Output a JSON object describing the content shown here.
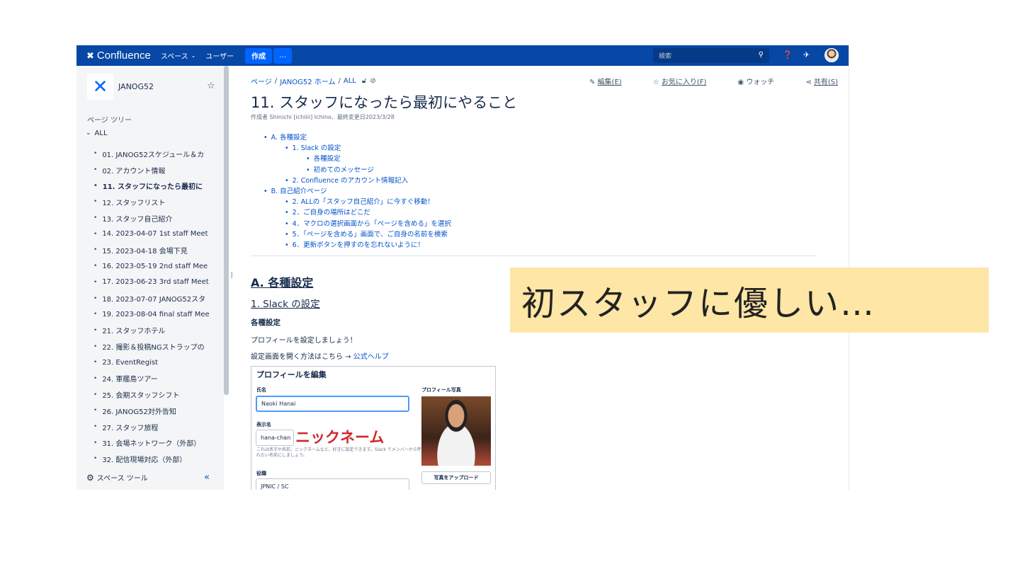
{
  "nav": {
    "brand": "Confluence",
    "spaces": "スペース",
    "users": "ユーザー",
    "create": "作成",
    "more": "…",
    "search_placeholder": "検索"
  },
  "sidebar": {
    "space_name": "JANOG52",
    "tree_heading": "ページ ツリー",
    "root": "ALL",
    "items": [
      "01. JANOG52スケジュール＆カ",
      "02. アカウント情報",
      "11. スタッフになったら最初に",
      "12. スタッフリスト",
      "13. スタッフ自己紹介",
      "14. 2023-04-07 1st staff Meet",
      "15. 2023-04-18 会場下見",
      "16. 2023-05-19 2nd staff Mee",
      "17. 2023-06-23 3rd staff Meet",
      "18. 2023-07-07 JANOG52スタ",
      "19. 2023-08-04 final staff Mee",
      "21. スタッフホテル",
      "22. 撮影＆投稿NGストラップの",
      "23. EventRegist",
      "24. 軍艦島ツアー",
      "25. 会期スタッフシフト",
      "26. JANOG52対外告知",
      "27. スタッフ旅程",
      "31. 会場ネットワーク（外部）",
      "32. 配信現場対応（外部）"
    ],
    "active_index": 2,
    "space_tools": "スペース ツール",
    "collapse": "«"
  },
  "page": {
    "breadcrumb": [
      "ページ",
      "JANOG52 ホーム",
      "ALL"
    ],
    "actions": {
      "edit": "編集(E)",
      "favorite": "お気に入り(F)",
      "watch": "ウォッチ",
      "share": "共有(S)",
      "more": "⋯"
    },
    "title": "11. スタッフになったら最初にやること",
    "byline": "作成者 Shinichi [ichiiii] Ichino、最終変更日2023/3/28",
    "toc": [
      {
        "level": 1,
        "text": "A. 各種設定"
      },
      {
        "level": 2,
        "text": "1. Slack の設定"
      },
      {
        "level": 3,
        "text": "各種設定"
      },
      {
        "level": 3,
        "text": "初めてのメッセージ"
      },
      {
        "level": 2,
        "text": "2. Confluence のアカウント情報記入"
      },
      {
        "level": 1,
        "text": "B. 自己紹介ページ"
      },
      {
        "level": 2,
        "text": "2. ALLの「スタッフ自己紹介」に今すぐ移動！"
      },
      {
        "level": 2,
        "text": "2．ご自身の場所はどこだ"
      },
      {
        "level": 2,
        "text": "4．マクロの選択画面から「ページを含める」を選択"
      },
      {
        "level": 2,
        "text": "5．「ページを含める」画面で、ご自身の名前を検索"
      },
      {
        "level": 2,
        "text": "6．更新ボタンを押すのを忘れないように！"
      }
    ],
    "h2": "A. 各種設定",
    "h3": "1. Slack の設定",
    "h4": "各種設定",
    "p1": "プロフィールを設定しましょう！",
    "p2_text": "設定画面を開く方法はこちら → ",
    "p2_link": "公式ヘルプ"
  },
  "embedded_profile": {
    "title": "プロフィールを編集",
    "name_label": "氏名",
    "name_value": "Naoki Hanai",
    "display_label": "表示名",
    "display_value": "hana-chan",
    "nickname_annotation": "ニックネーム",
    "help_text": "これは名字や名前、ニックネームなど、好きに設定できます。Slack でメンバーから呼ばれたい名前にしましょう。",
    "role_label": "役職",
    "role_value": "JPNIC / SC",
    "photo_label": "プロフィール写真",
    "upload_button": "写真をアップロード"
  },
  "callout": "初スタッフに優しい…"
}
